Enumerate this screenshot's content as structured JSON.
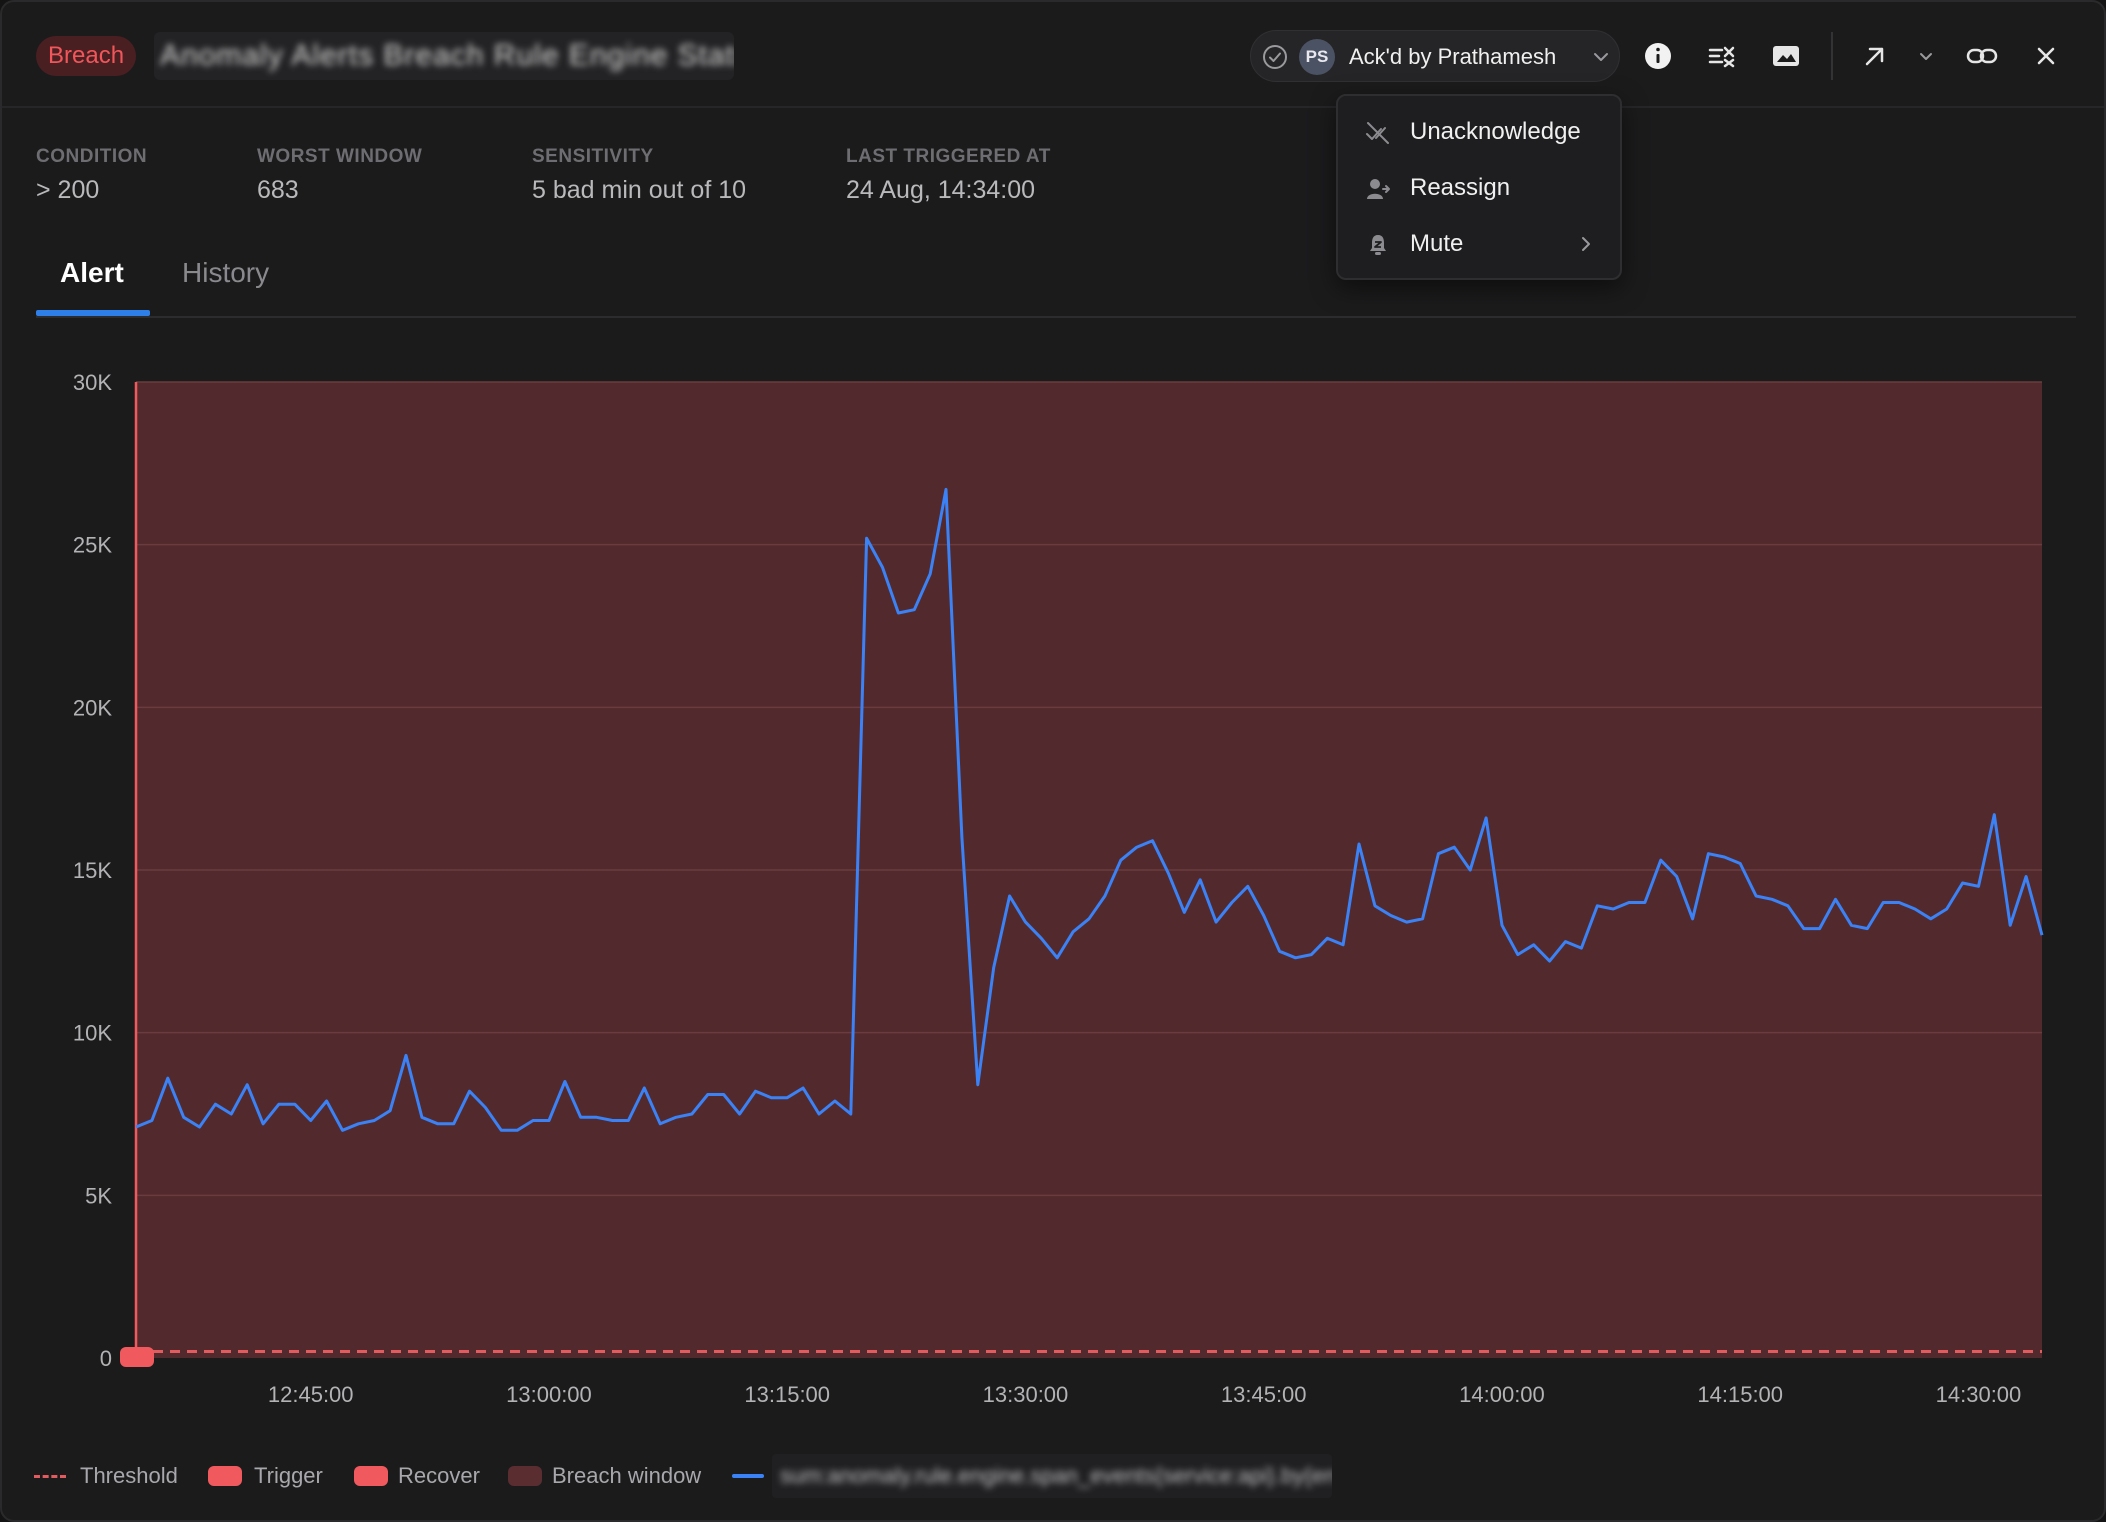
{
  "header": {
    "badge": "Breach",
    "title_obscured": "Anomaly Alerts Breach Rule Engine Status",
    "ack": {
      "avatar_initials": "PS",
      "label": "Ack'd by Prathamesh"
    },
    "icons": [
      "check-circle-icon",
      "chevron-down-icon",
      "info-icon",
      "checklist-icon",
      "image-icon",
      "arrow-up-right-icon",
      "chevron-down-icon",
      "link-icon",
      "close-icon"
    ]
  },
  "menu": {
    "items": [
      {
        "label": "Unacknowledge",
        "icon": "unacknowledge-icon"
      },
      {
        "label": "Reassign",
        "icon": "reassign-icon"
      },
      {
        "label": "Mute",
        "icon": "bell-mute-icon",
        "has_submenu": true
      }
    ]
  },
  "stats": [
    {
      "label": "CONDITION",
      "value": "> 200"
    },
    {
      "label": "WORST WINDOW",
      "value": "683"
    },
    {
      "label": "SENSITIVITY",
      "value": "5 bad min out of 10"
    },
    {
      "label": "LAST TRIGGERED AT",
      "value": "24 Aug, 14:34:00"
    }
  ],
  "tabs": [
    {
      "label": "Alert",
      "active": true
    },
    {
      "label": "History",
      "active": false
    }
  ],
  "colors": {
    "breach_fill": "#522a2d",
    "line": "#3b82f6",
    "threshold": "#e25b5f",
    "trigger": "#f05a5e",
    "recover": "#f05a5e",
    "breach_window": "#5a2e31",
    "accent": "#2e7fe8"
  },
  "chart_data": {
    "type": "line",
    "x_tick_labels": [
      "12:45:00",
      "13:00:00",
      "13:15:00",
      "13:30:00",
      "13:45:00",
      "14:00:00",
      "14:15:00",
      "14:30:00"
    ],
    "y_tick_labels": [
      "0",
      "5K",
      "10K",
      "15K",
      "20K",
      "25K",
      "30K"
    ],
    "ylim": [
      0,
      30000
    ],
    "xlim_minutes": [
      0,
      120
    ],
    "x_start_time": "12:34:00",
    "threshold": 200,
    "breach_window": "entire range",
    "series": [
      {
        "name_obscured": "sum:anomaly.rule.engine.span_events",
        "x_minutes": [
          0,
          1,
          2,
          3,
          4,
          5,
          6,
          7,
          8,
          9,
          10,
          11,
          12,
          13,
          14,
          15,
          16,
          17,
          18,
          19,
          20,
          21,
          22,
          23,
          24,
          25,
          26,
          27,
          28,
          29,
          30,
          31,
          32,
          33,
          34,
          35,
          36,
          37,
          38,
          39,
          40,
          41,
          42,
          43,
          44,
          45,
          46,
          47,
          48,
          49,
          50,
          51,
          52,
          53,
          54,
          55,
          56,
          57,
          58,
          59,
          60,
          61,
          62,
          63,
          64,
          65,
          66,
          67,
          68,
          69,
          70,
          71,
          72,
          73,
          74,
          75,
          76,
          77,
          78,
          79,
          80,
          81,
          82,
          83,
          84,
          85,
          86,
          87,
          88,
          89,
          90,
          91,
          92,
          93,
          94,
          95,
          96,
          97,
          98,
          99,
          100,
          101,
          102,
          103,
          104,
          105,
          106,
          107,
          108,
          109,
          110,
          111,
          112,
          113,
          114,
          115,
          116,
          117,
          118,
          119,
          120
        ],
        "values": [
          7100,
          7300,
          8600,
          7400,
          7100,
          7800,
          7500,
          8400,
          7200,
          7800,
          7800,
          7300,
          7900,
          7000,
          7200,
          7300,
          7600,
          9300,
          7400,
          7200,
          7200,
          8200,
          7700,
          7000,
          7000,
          7300,
          7300,
          8500,
          7400,
          7400,
          7300,
          7300,
          8300,
          7200,
          7400,
          7500,
          8100,
          8100,
          7500,
          8200,
          8000,
          8000,
          8300,
          7500,
          7900,
          7500,
          25200,
          24300,
          22900,
          23000,
          24100,
          26700,
          16000,
          8400,
          12000,
          14200,
          13400,
          12900,
          12300,
          13100,
          13500,
          14200,
          15300,
          15700,
          15900,
          14900,
          13700,
          14700,
          13400,
          14000,
          14500,
          13600,
          12500,
          12300,
          12400,
          12900,
          12700,
          15800,
          13900,
          13600,
          13400,
          13500,
          15500,
          15700,
          15000,
          16600,
          13300,
          12400,
          12700,
          12200,
          12800,
          12600,
          13900,
          13800,
          14000,
          14000,
          15300,
          14800,
          13500,
          15500,
          15400,
          15200,
          14200,
          14100,
          13900,
          13200,
          13200,
          14100,
          13300,
          13200,
          14000,
          14000,
          13800,
          13500,
          13800,
          14600,
          14500,
          16700,
          13300,
          14800,
          13000
        ]
      }
    ]
  },
  "legend": [
    {
      "label": "Threshold",
      "kind": "dash"
    },
    {
      "label": "Trigger",
      "kind": "swatch"
    },
    {
      "label": "Recover",
      "kind": "swatch"
    },
    {
      "label": "Breach window",
      "kind": "swatch"
    }
  ],
  "legend_series_obscured": "sum:anomaly.rule.engine.span_events{service:api}.by{env}"
}
